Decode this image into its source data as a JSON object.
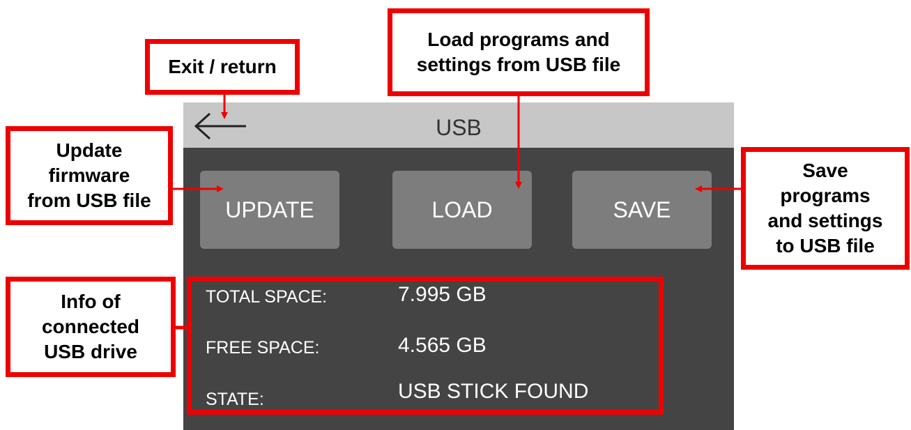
{
  "app": {
    "title": "USB",
    "back_icon": "left-arrow-icon",
    "buttons": {
      "update": "UPDATE",
      "load": "LOAD",
      "save": "SAVE"
    },
    "info": [
      {
        "label": "TOTAL SPACE:",
        "value": "7.995 GB"
      },
      {
        "label": "FREE SPACE:",
        "value": "4.565 GB"
      },
      {
        "label": "STATE:",
        "value": "USB STICK FOUND"
      }
    ]
  },
  "annotations": {
    "exit": "Exit / return",
    "load": "Load programs and\nsettings from USB file",
    "update": "Update\nfirmware\nfrom USB file",
    "save": "Save\nprograms\nand settings\nto USB file",
    "info": "Info of\nconnected\nUSB drive"
  },
  "colors": {
    "annotation": "#ee0000",
    "screen_bg": "#444444",
    "titlebar_bg": "#c7c7c7",
    "button_bg": "#7d7d7d"
  }
}
